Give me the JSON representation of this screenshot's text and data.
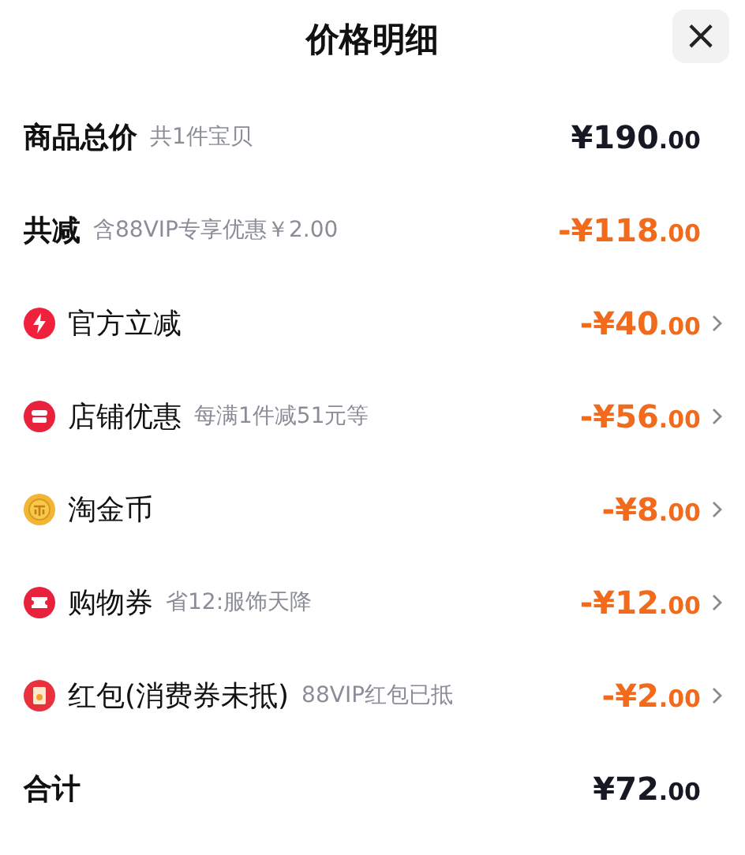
{
  "title": "价格明细",
  "close": "×",
  "rows": [
    {
      "kind": "summary",
      "label": "商品总价",
      "note": "共1件宝贝",
      "amount": "¥190",
      "cents": ".00",
      "discount": false
    },
    {
      "kind": "summary",
      "label": "共减",
      "note": "含88VIP专享优惠￥2.00",
      "amount": "-¥118",
      "cents": ".00",
      "discount": true
    },
    {
      "kind": "lightning",
      "label": "官方立减",
      "amount": "-¥40",
      "cents": ".00",
      "discount": true
    },
    {
      "kind": "shop",
      "label": "店铺优惠",
      "note": "每满1件减51元等",
      "amount": "-¥56",
      "cents": ".00",
      "discount": true
    },
    {
      "kind": "coin",
      "label": "淘金币",
      "amount": "-¥8",
      "cents": ".00",
      "discount": true
    },
    {
      "kind": "ticket",
      "label": "购物券",
      "note": "省12:服饰天降",
      "amount": "-¥12",
      "cents": ".00",
      "discount": true
    },
    {
      "kind": "envelope",
      "label": "红包(消费券未抵)",
      "note": "88VIP红包已抵",
      "amount": "-¥2",
      "cents": ".00",
      "discount": true
    },
    {
      "kind": "summary",
      "label": "合计",
      "amount": "¥72",
      "cents": ".00",
      "discount": false
    }
  ]
}
